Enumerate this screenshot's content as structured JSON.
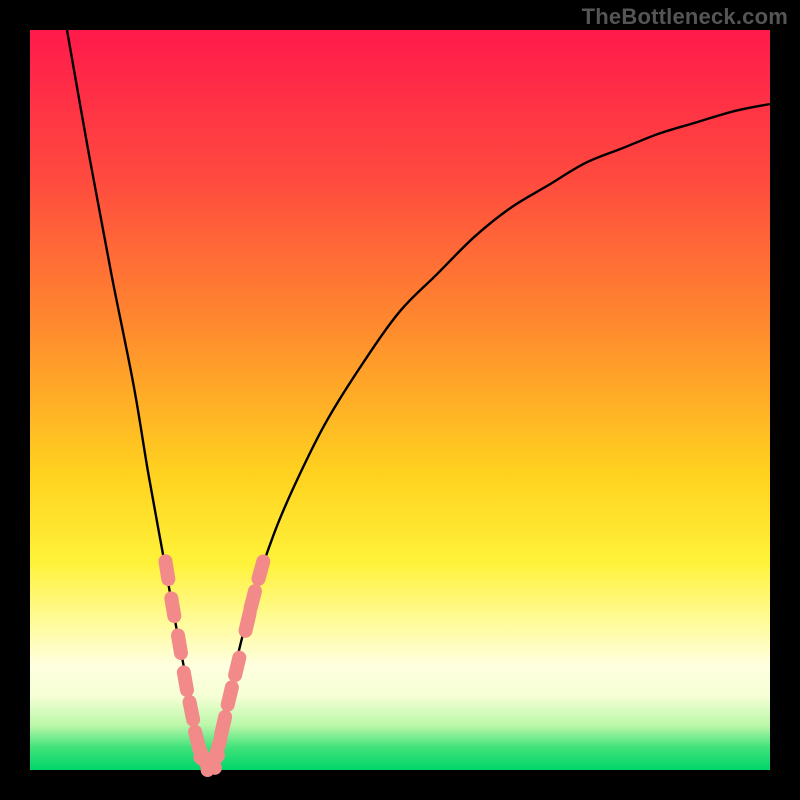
{
  "watermark": "TheBottleneck.com",
  "chart_data": {
    "type": "line",
    "title": "",
    "xlabel": "",
    "ylabel": "",
    "xlim": [
      0,
      100
    ],
    "ylim": [
      0,
      100
    ],
    "grid": false,
    "legend": false,
    "background_gradient_stops": [
      {
        "pos": 0.0,
        "color": "#ff1a4b"
      },
      {
        "pos": 0.2,
        "color": "#ff4a3f"
      },
      {
        "pos": 0.4,
        "color": "#ff8a2e"
      },
      {
        "pos": 0.6,
        "color": "#ffd21f"
      },
      {
        "pos": 0.72,
        "color": "#fff23a"
      },
      {
        "pos": 0.8,
        "color": "#fffb9a"
      },
      {
        "pos": 0.86,
        "color": "#ffffe0"
      },
      {
        "pos": 0.9,
        "color": "#f5ffd5"
      },
      {
        "pos": 0.94,
        "color": "#baf7a8"
      },
      {
        "pos": 0.97,
        "color": "#3fe27a"
      },
      {
        "pos": 1.0,
        "color": "#00d66a"
      }
    ],
    "series": [
      {
        "name": "bottleneck-curve",
        "note": "x in 0–100 arbitrary units, y = bottleneck percentage 0–100",
        "x": [
          5,
          8,
          11,
          14,
          16,
          18,
          20,
          22,
          23.5,
          25,
          27,
          30,
          33,
          36,
          40,
          45,
          50,
          55,
          60,
          65,
          70,
          75,
          80,
          85,
          90,
          95,
          100
        ],
        "y": [
          100,
          83,
          67,
          52,
          40,
          29,
          18,
          8,
          1,
          2,
          11,
          23,
          32,
          39,
          47,
          55,
          62,
          67,
          72,
          76,
          79,
          82,
          84,
          86,
          87.5,
          89,
          90
        ]
      }
    ],
    "scatter": {
      "name": "highlight-dots",
      "color": "#f28a8a",
      "note": "pink segment markers along the curve near the minimum",
      "points": [
        {
          "x": 18.5,
          "y": 27
        },
        {
          "x": 19.3,
          "y": 22
        },
        {
          "x": 20.2,
          "y": 17
        },
        {
          "x": 21.0,
          "y": 12
        },
        {
          "x": 21.8,
          "y": 8
        },
        {
          "x": 22.6,
          "y": 4
        },
        {
          "x": 23.3,
          "y": 2
        },
        {
          "x": 24.0,
          "y": 1
        },
        {
          "x": 24.7,
          "y": 1
        },
        {
          "x": 25.4,
          "y": 3
        },
        {
          "x": 26.1,
          "y": 6
        },
        {
          "x": 27.0,
          "y": 10
        },
        {
          "x": 28.0,
          "y": 14
        },
        {
          "x": 29.4,
          "y": 20
        },
        {
          "x": 30.1,
          "y": 23
        },
        {
          "x": 31.2,
          "y": 27
        }
      ]
    }
  }
}
